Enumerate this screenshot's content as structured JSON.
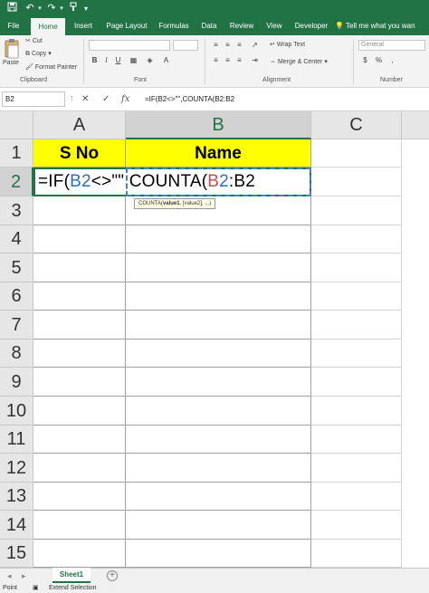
{
  "quick_access": {
    "save_icon": "save-icon",
    "undo_icon": "undo-icon",
    "redo_icon": "redo-icon",
    "brush_icon": "paintbrush-icon",
    "customize_icon": "chevron-down-icon"
  },
  "tabs": [
    "File",
    "Home",
    "Insert",
    "Page Layout",
    "Formulas",
    "Data",
    "Review",
    "View",
    "Developer"
  ],
  "active_tab": "Home",
  "tell_me": "Tell me what you wan",
  "ribbon": {
    "paste_label": "Paste",
    "cut_label": "Cut",
    "copy_label": "Copy",
    "format_painter_label": "Format Painter",
    "clipboard_group": "Clipboard",
    "font_group": "Font",
    "wrap_text_label": "Wrap Text",
    "merge_center_label": "Merge & Center",
    "alignment_group": "Alignment",
    "number_format_value": "General",
    "number_group": "Number"
  },
  "formula_bar": {
    "name_box": "B2",
    "cancel_glyph": "✕",
    "enter_glyph": "✓",
    "fx_glyph": "fx",
    "formula": "=IF(B2<>\"\",COUNTA(B2:B2"
  },
  "columns": [
    "A",
    "B",
    "C"
  ],
  "selected_column": "B",
  "rows": [
    "1",
    "2",
    "3",
    "4",
    "5",
    "6",
    "7",
    "8",
    "9",
    "10",
    "11",
    "12",
    "13",
    "14",
    "15"
  ],
  "header_row": {
    "a1": "S No",
    "b1": "Name"
  },
  "editing": {
    "part1": "=IF(",
    "part2": "B2",
    "part3": "<>\"\",COUNTA(",
    "part4": "B",
    "part5": "2",
    "part6": ":B2",
    "tooltip_prefix": "COUNTA(",
    "tooltip_arg1": "value1",
    "tooltip_rest": ", [value2], ...)"
  },
  "sheet_tabs": [
    "Sheet1"
  ],
  "add_sheet_glyph": "+",
  "status": {
    "mode": "Point",
    "extend": "Extend Selection"
  },
  "colors": {
    "excel_green": "#217346",
    "header_fill": "#ffff00",
    "ref_blue": "#2f6fb5",
    "ref_red": "#c0504d"
  }
}
